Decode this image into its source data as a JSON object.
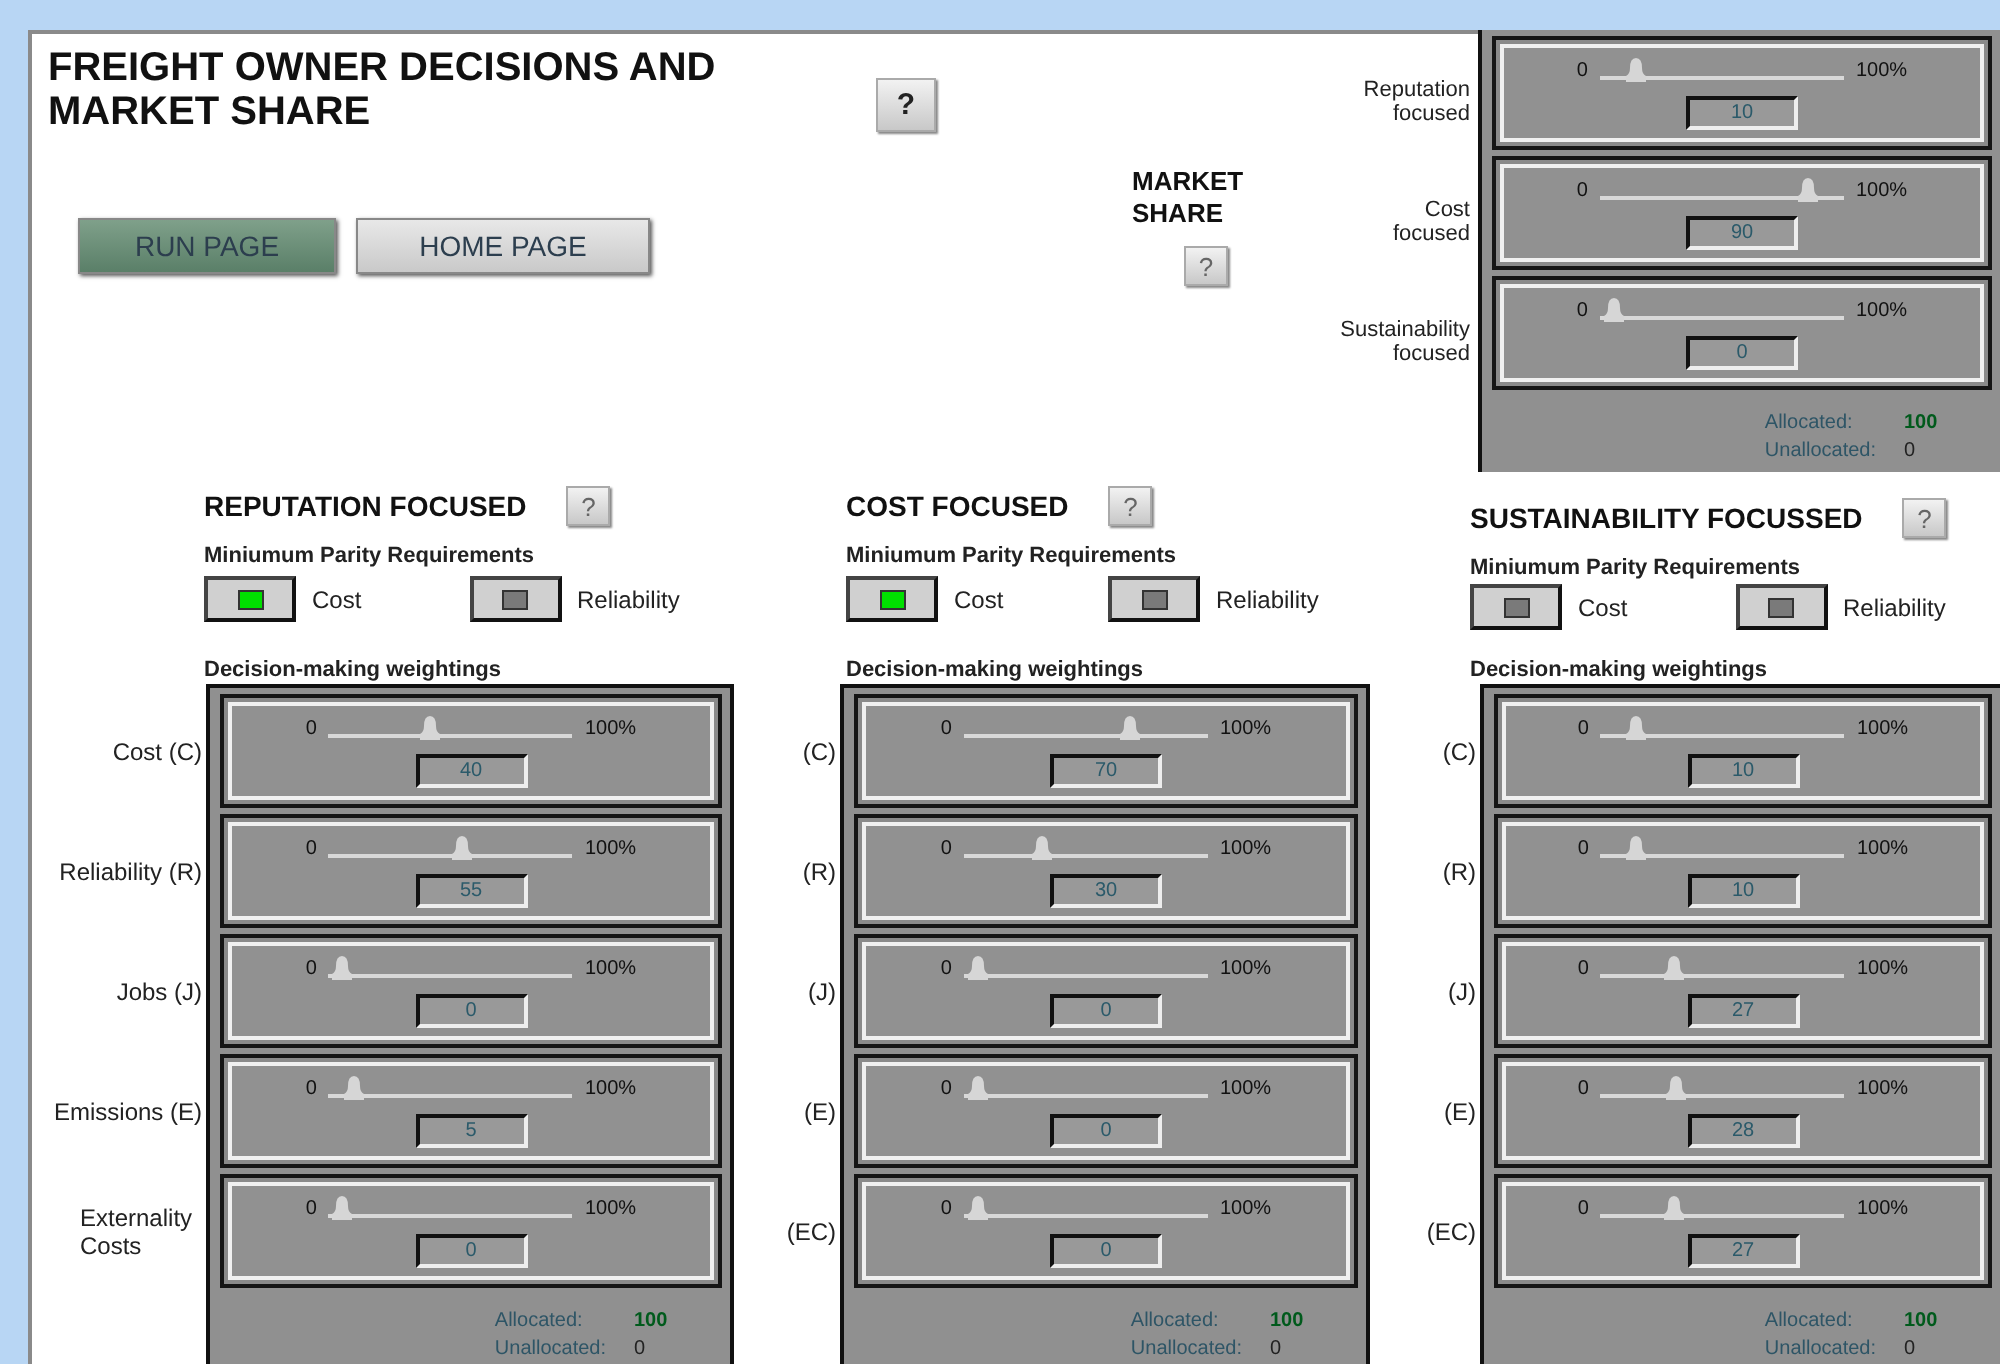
{
  "title": "FREIGHT OWNER DECISIONS AND MARKET SHARE",
  "help": "?",
  "buttons": [
    {
      "label": "RUN PAGE",
      "selected": true
    },
    {
      "label": "HOME PAGE",
      "selected": false
    }
  ],
  "market_share": {
    "title": "MARKET SHARE",
    "help": "?",
    "sliders": [
      {
        "label": "Reputation focused",
        "min": "0",
        "max": "100%",
        "value": "10",
        "level": 0.1
      },
      {
        "label": "Cost focused",
        "min": "0",
        "max": "100%",
        "value": "90",
        "level": 0.9
      },
      {
        "label": "Sustainability focused",
        "min": "0",
        "max": "100%",
        "value": "0",
        "level": 0
      }
    ],
    "allocated_label": "Allocated:",
    "allocated": "100",
    "unallocated_label": "Unallocated:",
    "unallocated": "0"
  },
  "groups": [
    {
      "title": "REPUTATION FOCUSED",
      "help": "?",
      "parity_title": "Miniumum Parity Requirements",
      "parity": [
        {
          "label": "Cost",
          "on": true
        },
        {
          "label": "Reliability",
          "on": false
        }
      ],
      "weightings_title": "Decision-making weightings",
      "sliders": [
        {
          "label": "Cost (C)",
          "min": "0",
          "max": "100%",
          "value": "40",
          "level": 0.4
        },
        {
          "label": "Reliability (R)",
          "min": "0",
          "max": "100%",
          "value": "55",
          "level": 0.55
        },
        {
          "label": "Jobs (J)",
          "min": "0",
          "max": "100%",
          "value": "0",
          "level": 0
        },
        {
          "label": "Emissions (E)",
          "min": "0",
          "max": "100%",
          "value": "5",
          "level": 0.05
        },
        {
          "label": "Externality Costs",
          "min": "0",
          "max": "100%",
          "value": "0",
          "level": 0
        }
      ],
      "allocated_label": "Allocated:",
      "allocated": "100",
      "unallocated_label": "Unallocated:",
      "unallocated": "0"
    },
    {
      "title": "COST FOCUSED",
      "help": "?",
      "parity_title": "Miniumum Parity Requirements",
      "parity": [
        {
          "label": "Cost",
          "on": true
        },
        {
          "label": "Reliability",
          "on": false
        }
      ],
      "weightings_title": "Decision-making weightings",
      "sliders": [
        {
          "label": "(C)",
          "min": "0",
          "max": "100%",
          "value": "70",
          "level": 0.7
        },
        {
          "label": "(R)",
          "min": "0",
          "max": "100%",
          "value": "30",
          "level": 0.3
        },
        {
          "label": "(J)",
          "min": "0",
          "max": "100%",
          "value": "0",
          "level": 0
        },
        {
          "label": "(E)",
          "min": "0",
          "max": "100%",
          "value": "0",
          "level": 0
        },
        {
          "label": "(EC)",
          "min": "0",
          "max": "100%",
          "value": "0",
          "level": 0
        }
      ],
      "allocated_label": "Allocated:",
      "allocated": "100",
      "unallocated_label": "Unallocated:",
      "unallocated": "0"
    },
    {
      "title": "SUSTAINABILITY FOCUSSED",
      "help": "?",
      "parity_title": "Miniumum Parity Requirements",
      "parity": [
        {
          "label": "Cost",
          "on": false
        },
        {
          "label": "Reliability",
          "on": false
        }
      ],
      "weightings_title": "Decision-making weightings",
      "sliders": [
        {
          "label": "(C)",
          "min": "0",
          "max": "100%",
          "value": "10",
          "level": 0.1
        },
        {
          "label": "(R)",
          "min": "0",
          "max": "100%",
          "value": "10",
          "level": 0.1
        },
        {
          "label": "(J)",
          "min": "0",
          "max": "100%",
          "value": "27",
          "level": 0.27
        },
        {
          "label": "(E)",
          "min": "0",
          "max": "100%",
          "value": "28",
          "level": 0.28
        },
        {
          "label": "(EC)",
          "min": "0",
          "max": "100%",
          "value": "27",
          "level": 0.27
        }
      ],
      "allocated_label": "Allocated:",
      "allocated": "100",
      "unallocated_label": "Unallocated:",
      "unallocated": "0"
    }
  ]
}
